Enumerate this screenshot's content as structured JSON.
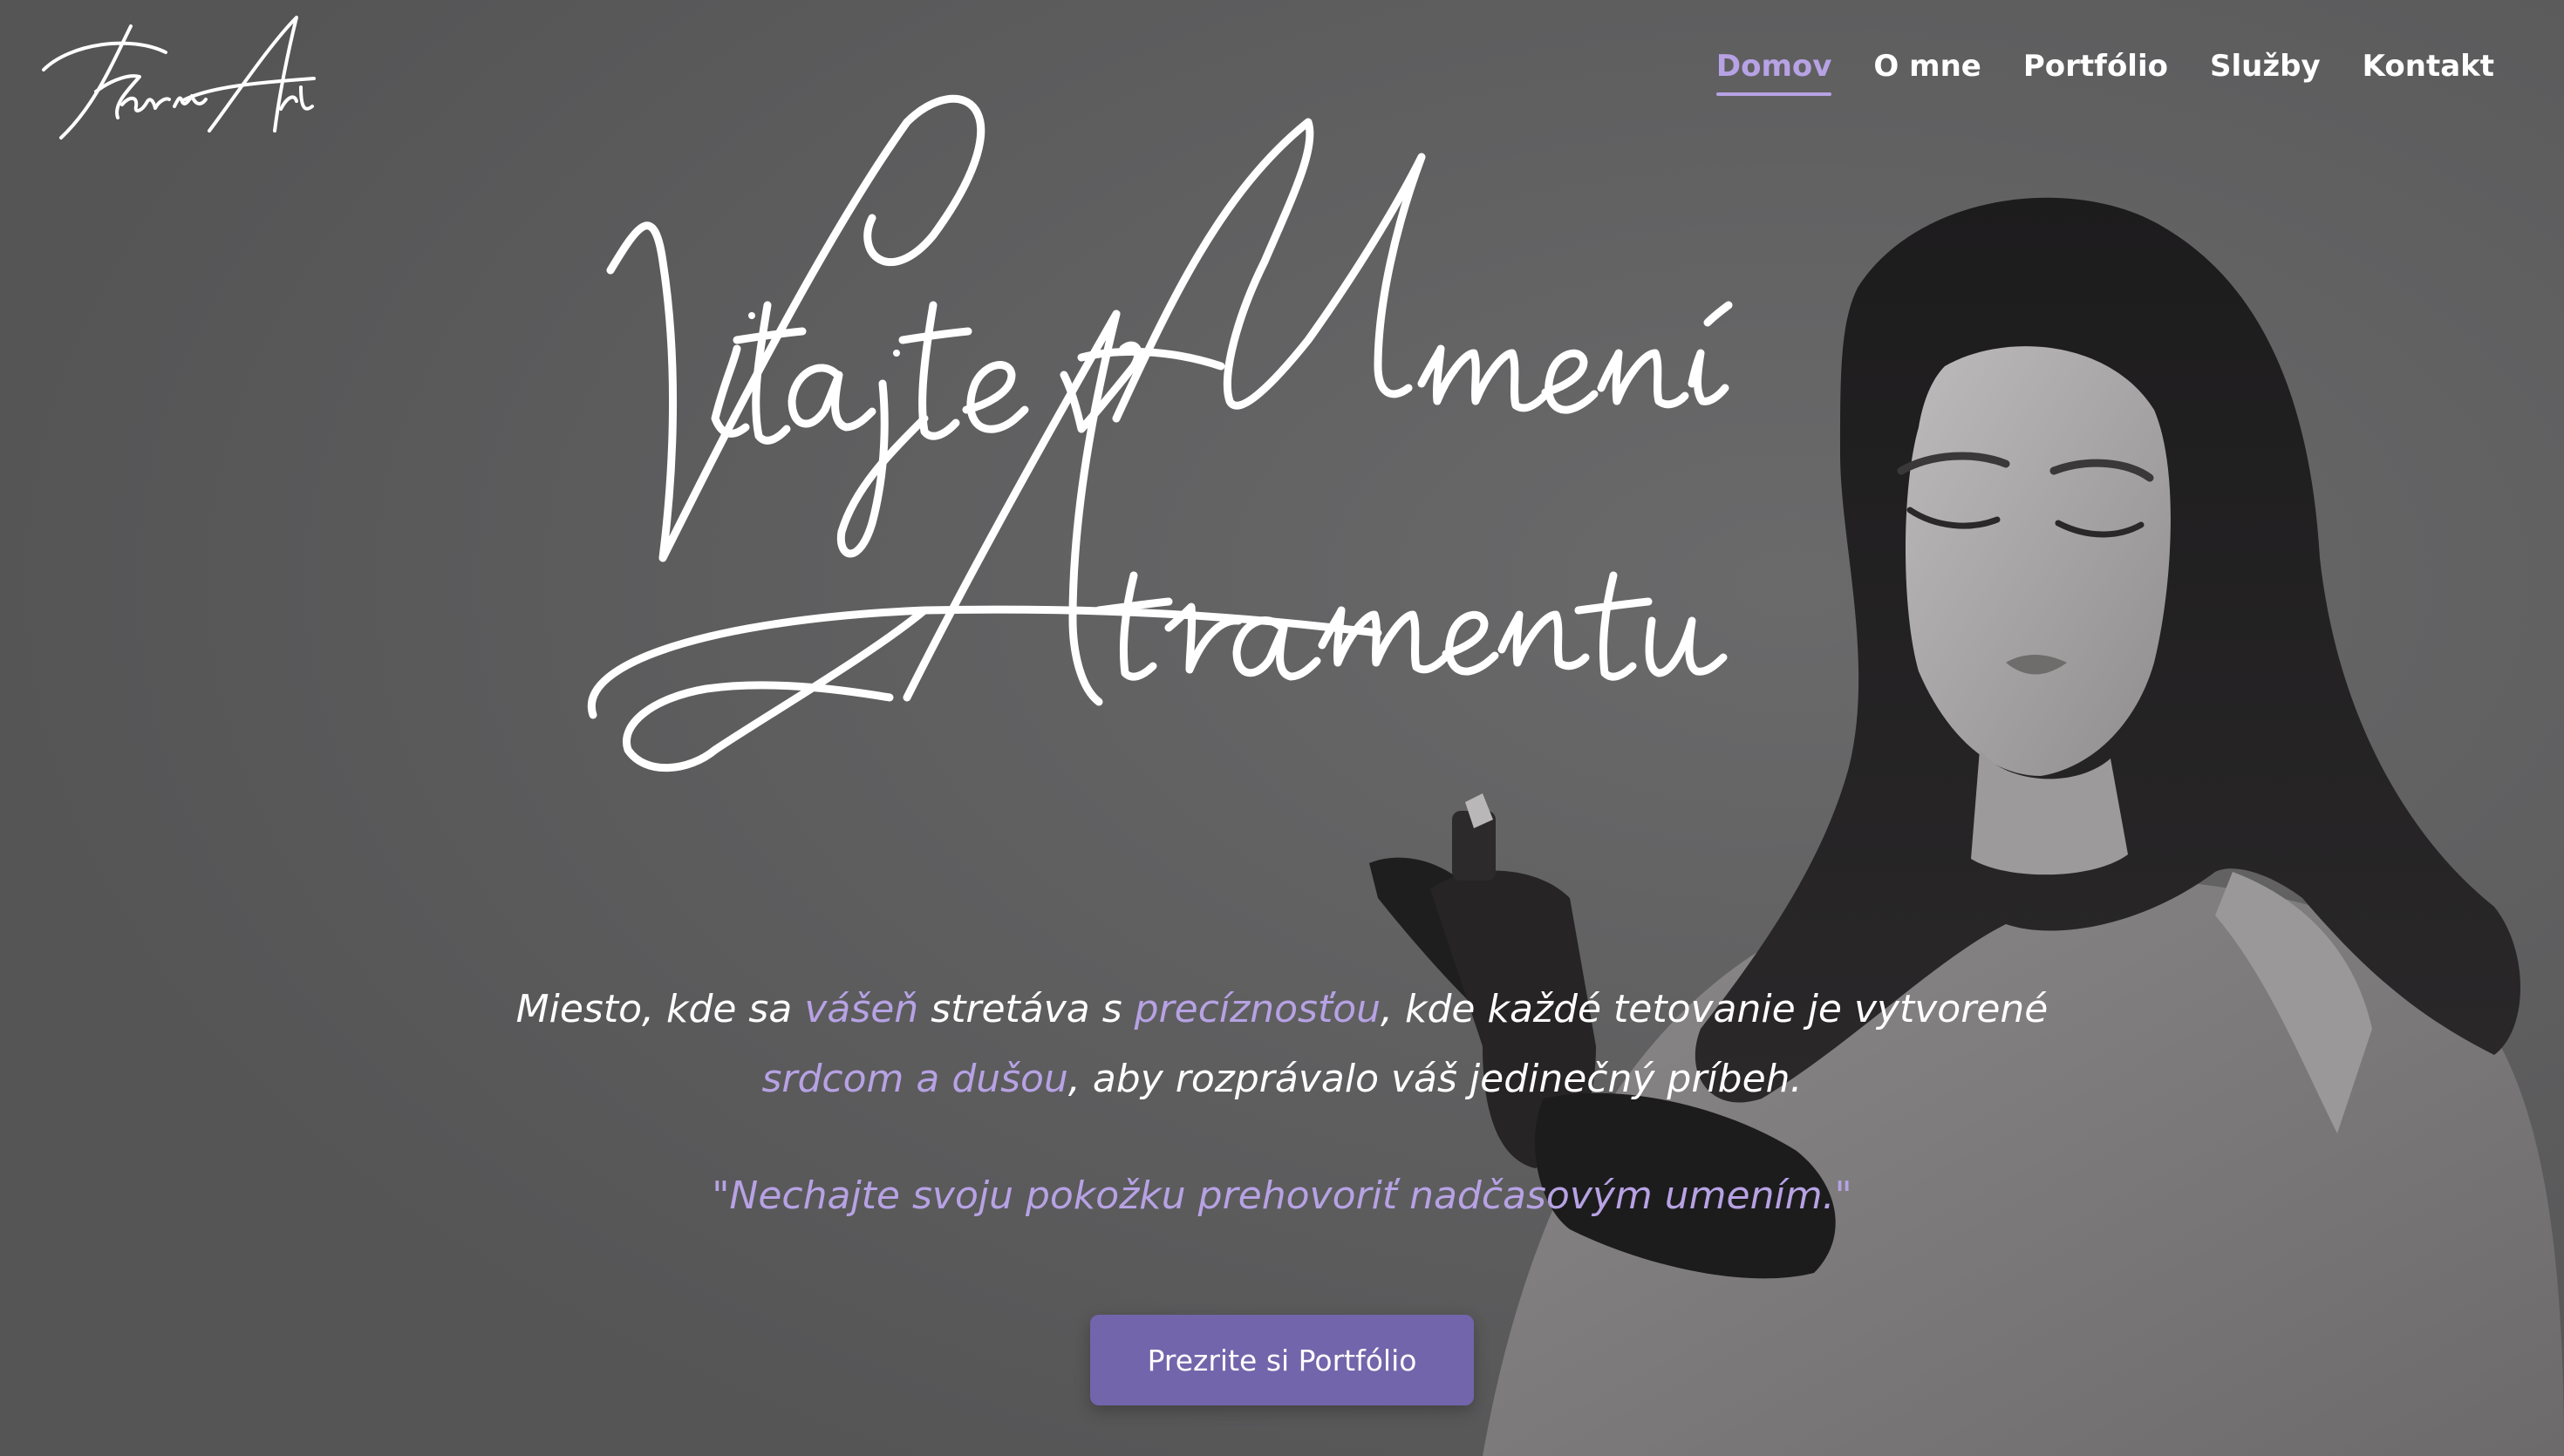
{
  "brand": {
    "logo_text": "Karin Art"
  },
  "nav": {
    "items": [
      {
        "label": "Domov",
        "active": true
      },
      {
        "label": "O mne",
        "active": false
      },
      {
        "label": "Portfólio",
        "active": false
      },
      {
        "label": "Služby",
        "active": false
      },
      {
        "label": "Kontakt",
        "active": false
      }
    ]
  },
  "hero": {
    "title_line1": "Vitajte v Umení",
    "title_line2": "Atramentu",
    "tagline": {
      "p1": "Miesto, kde sa ",
      "a1": "vášeň",
      "p2": " stretáva s ",
      "a2": "precíznosťou",
      "p3": ", kde každé tetovanie je vytvorené ",
      "a3": "srdcom a dušou",
      "p4": ", aby rozprávalo váš jedinečný príbeh."
    },
    "quote": "\"Nechajte svoju pokožku prehovoriť nadčasovým umením.\"",
    "cta_label": "Prezrite si Portfólio"
  },
  "colors": {
    "accent": "#b7a2e4",
    "button": "#7265ab",
    "background": "#5d5d5e",
    "text": "#ffffff"
  }
}
